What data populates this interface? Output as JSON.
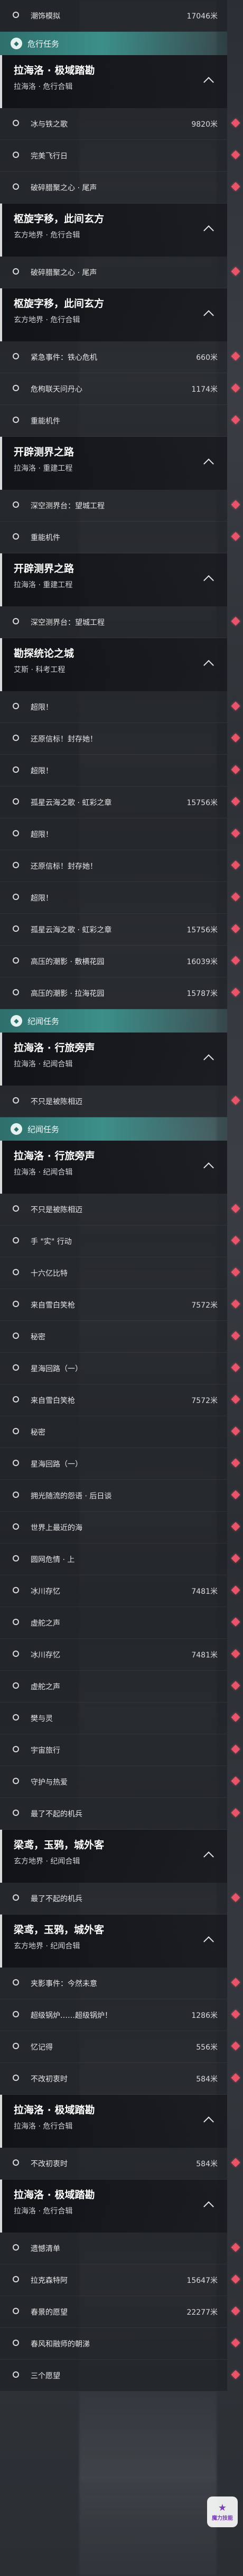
{
  "sections": [
    {
      "type": "item",
      "label": "潮饰模拟",
      "dist": "17046米"
    },
    {
      "type": "category",
      "label": "危行任务"
    },
    {
      "type": "quest",
      "title": "拉海洛 · 极域踏勘",
      "sub": "拉海洛 · 危行合辑"
    },
    {
      "type": "item",
      "label": "冰与铁之歌",
      "dist": "9820米",
      "marker": true
    },
    {
      "type": "item",
      "label": "完美飞行日",
      "dist": "",
      "marker": true
    },
    {
      "type": "item",
      "label": "破碎腊聚之心 · 尾声",
      "dist": "",
      "marker": true
    },
    {
      "type": "quest",
      "title": "枢旋字移，此间玄方",
      "sub": "玄方地界 · 危行合辑"
    },
    {
      "type": "item",
      "label": "破碎腊聚之心 · 尾声",
      "dist": "",
      "marker": true
    },
    {
      "type": "quest",
      "title": "枢旋字移，此间玄方",
      "sub": "玄方地界 · 危行合辑"
    },
    {
      "type": "item",
      "label": "紧急事件：铁心危机",
      "dist": "660米",
      "marker": true
    },
    {
      "type": "item",
      "label": "危枸联天问丹心",
      "dist": "1174米",
      "marker": true
    },
    {
      "type": "item",
      "label": "重能机件",
      "dist": "",
      "marker": true
    },
    {
      "type": "quest",
      "title": "开辟测界之路",
      "sub": "拉海洛 · 重建工程"
    },
    {
      "type": "item",
      "label": "深空测界台：望城工程",
      "dist": "",
      "marker": true
    },
    {
      "type": "item",
      "label": "重能机件",
      "dist": "",
      "marker": true
    },
    {
      "type": "quest",
      "title": "开辟测界之路",
      "sub": "拉海洛 · 重建工程"
    },
    {
      "type": "item",
      "label": "深空测界台：望城工程",
      "dist": "",
      "marker": true
    },
    {
      "type": "quest",
      "title": "勘探统论之城",
      "sub": "艾斯 · 科考工程"
    },
    {
      "type": "item",
      "label": "超限！",
      "dist": "",
      "marker": true
    },
    {
      "type": "item",
      "label": "还原信标！封存她！",
      "dist": "",
      "marker": true
    },
    {
      "type": "item",
      "label": "超限！",
      "dist": "",
      "marker": true
    },
    {
      "type": "item",
      "label": "孤星云海之歌 · 虹彩之章",
      "dist": "15756米",
      "marker": true
    },
    {
      "type": "item",
      "label": "超限！",
      "dist": "",
      "marker": true
    },
    {
      "type": "item",
      "label": "还原信标！封存她！",
      "dist": "",
      "marker": true
    },
    {
      "type": "item",
      "label": "超限！",
      "dist": "",
      "marker": true
    },
    {
      "type": "item",
      "label": "孤星云海之歌 · 虹彩之章",
      "dist": "15756米",
      "marker": true
    },
    {
      "type": "item",
      "label": "高压的潮影 · 敷横花园",
      "dist": "16039米",
      "marker": true
    },
    {
      "type": "item",
      "label": "高压的潮影 · 拉海花园",
      "dist": "15787米",
      "marker": true
    },
    {
      "type": "category",
      "label": "纪闻任务"
    },
    {
      "type": "quest",
      "title": "拉海洛 · 行旅旁声",
      "sub": "拉海洛 · 纪闻合辑"
    },
    {
      "type": "item",
      "label": "不只是被陈相迈",
      "dist": "",
      "marker": true
    },
    {
      "type": "category",
      "label": "纪闻任务"
    },
    {
      "type": "quest",
      "title": "拉海洛 · 行旅旁声",
      "sub": "拉海洛 · 纪闻合辑"
    },
    {
      "type": "item",
      "label": "不只是被陈相迈",
      "dist": "",
      "marker": true
    },
    {
      "type": "item",
      "label": "手 \"实\" 行动",
      "dist": "",
      "marker": true
    },
    {
      "type": "item",
      "label": "十六亿比特",
      "dist": "",
      "marker": true
    },
    {
      "type": "item",
      "label": "来自雪白笑枪",
      "dist": "7572米",
      "marker": true
    },
    {
      "type": "item",
      "label": "秘密",
      "dist": "",
      "marker": true
    },
    {
      "type": "item",
      "label": "星海回路（一）",
      "dist": "",
      "marker": true
    },
    {
      "type": "item",
      "label": "来自雪白笑枪",
      "dist": "7572米",
      "marker": true
    },
    {
      "type": "item",
      "label": "秘密",
      "dist": "",
      "marker": true
    },
    {
      "type": "item",
      "label": "星海回路（一）",
      "dist": "",
      "marker": true
    },
    {
      "type": "item",
      "label": "拥光随流的怨语 · 后日谈",
      "dist": "",
      "marker": true
    },
    {
      "type": "item",
      "label": "世界上最近的海",
      "dist": "",
      "marker": true
    },
    {
      "type": "item",
      "label": "圆网危情 · 上",
      "dist": "",
      "marker": true
    },
    {
      "type": "item",
      "label": "冰川存忆",
      "dist": "7481米",
      "marker": true
    },
    {
      "type": "item",
      "label": "虚舵之声",
      "dist": "",
      "marker": true
    },
    {
      "type": "item",
      "label": "冰川存忆",
      "dist": "7481米",
      "marker": true
    },
    {
      "type": "item",
      "label": "虚舵之声",
      "dist": "",
      "marker": true
    },
    {
      "type": "item",
      "label": "樊与灵",
      "dist": "",
      "marker": true
    },
    {
      "type": "item",
      "label": "宇宙旅行",
      "dist": "",
      "marker": true
    },
    {
      "type": "item",
      "label": "守护与热爱",
      "dist": "",
      "marker": true
    },
    {
      "type": "item",
      "label": "最了不起的机兵",
      "dist": "",
      "marker": true
    },
    {
      "type": "quest",
      "title": "梁鸢，玉鸦，城外客",
      "sub": "玄方地界 · 纪闻合辑"
    },
    {
      "type": "item",
      "label": "最了不起的机兵",
      "dist": "",
      "marker": true
    },
    {
      "type": "quest",
      "title": "梁鸢，玉鸦，城外客",
      "sub": "玄方地界 · 纪闻合辑"
    },
    {
      "type": "item",
      "label": "夹影事件：今然未意",
      "dist": "",
      "marker": true
    },
    {
      "type": "item",
      "label": "超级锅炉……超级锅炉！",
      "dist": "1286米",
      "marker": true
    },
    {
      "type": "item",
      "label": "忆记得",
      "dist": "556米",
      "marker": true
    },
    {
      "type": "item",
      "label": "不改初衷时",
      "dist": "584米",
      "marker": true
    },
    {
      "type": "quest",
      "title": "拉海洛 · 极域踏勘",
      "sub": "拉海洛 · 危行合辑"
    },
    {
      "type": "item",
      "label": "不改初衷时",
      "dist": "584米",
      "marker": true
    },
    {
      "type": "quest",
      "title": "拉海洛 · 极域踏勘",
      "sub": "拉海洛 · 危行合辑"
    },
    {
      "type": "item",
      "label": "遗憾清单",
      "dist": "",
      "marker": true
    },
    {
      "type": "item",
      "label": "拉克森特阿",
      "dist": "15647米",
      "marker": true
    },
    {
      "type": "item",
      "label": "春景的愿望",
      "dist": "22277米",
      "marker": true
    },
    {
      "type": "item",
      "label": "春风和融师的朝涕",
      "dist": "",
      "marker": true
    },
    {
      "type": "item",
      "label": "三个愿望",
      "dist": "",
      "marker": true
    }
  ],
  "overlay_logo": {
    "top": "★",
    "bottom": "魔力技能"
  }
}
